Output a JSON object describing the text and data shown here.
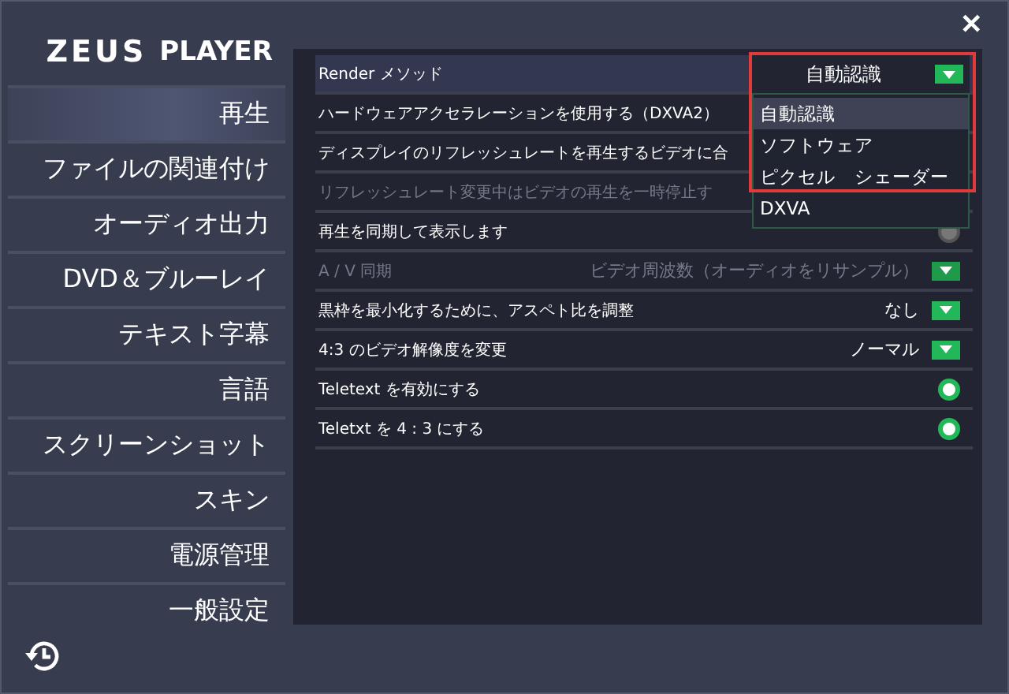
{
  "window": {
    "close": "✕"
  },
  "logo": {
    "brand": "ZEUS",
    "product": "PLAYER"
  },
  "sidebar": {
    "items": [
      {
        "label": "再生",
        "selected": true
      },
      {
        "label": "ファイルの関連付け",
        "selected": false
      },
      {
        "label": "オーディオ出力",
        "selected": false
      },
      {
        "label": "DVD＆ブルーレイ",
        "selected": false
      },
      {
        "label": "テキスト字幕",
        "selected": false
      },
      {
        "label": "言語",
        "selected": false
      },
      {
        "label": "スクリーンショット",
        "selected": false
      },
      {
        "label": "スキン",
        "selected": false
      },
      {
        "label": "電源管理",
        "selected": false
      },
      {
        "label": "一般設定",
        "selected": false
      }
    ]
  },
  "settings": [
    {
      "kind": "select",
      "label": "Render メソッド",
      "disabled": false,
      "value": "自動認識",
      "expanded": true,
      "options": [
        {
          "label": "自動認識",
          "selected": true
        },
        {
          "label": "ソフトウェア",
          "selected": false
        },
        {
          "label": "ピクセル　シェーダー",
          "selected": false
        },
        {
          "label": "DXVA",
          "selected": false
        }
      ]
    },
    {
      "kind": "plain",
      "label": "ハードウェアアクセラレーションを使用する（DXVA2）",
      "disabled": false
    },
    {
      "kind": "plain",
      "label": "ディスプレイのリフレッシュレートを再生するビデオに合",
      "disabled": false
    },
    {
      "kind": "plain",
      "label": "リフレッシュレート変更中はビデオの再生を一時停止す",
      "disabled": true
    },
    {
      "kind": "toggle",
      "label": "再生を同期して表示します",
      "disabled": false,
      "on": false
    },
    {
      "kind": "select",
      "label": "A / V 同期",
      "disabled": true,
      "value": "ビデオ周波数（オーディオをリサンプル）",
      "expanded": false
    },
    {
      "kind": "select",
      "label": "黒枠を最小化するために、アスペト比を調整",
      "disabled": false,
      "value": "なし",
      "expanded": false
    },
    {
      "kind": "select",
      "label": "4:3 のビデオ解像度を変更",
      "disabled": false,
      "value": "ノーマル",
      "expanded": false
    },
    {
      "kind": "toggle",
      "label": "Teletext を有効にする",
      "disabled": false,
      "on": true
    },
    {
      "kind": "toggle",
      "label": "Teletxt を 4 : 3 にする",
      "disabled": false,
      "on": true
    }
  ]
}
